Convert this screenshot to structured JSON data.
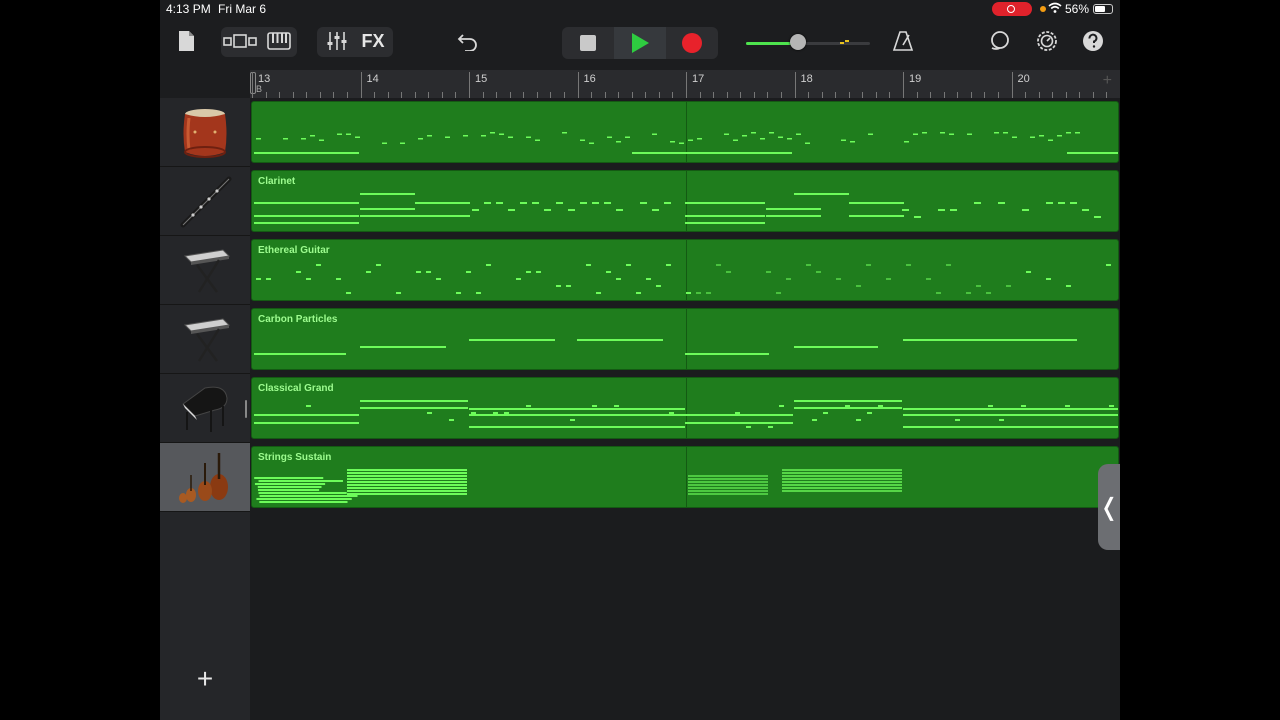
{
  "status_bar": {
    "time": "4:13 PM",
    "date": "Fri Mar 6",
    "battery": "56%"
  },
  "toolbar": {
    "fx_label": "FX",
    "icons": [
      "document-icon",
      "tracks-view-icon",
      "keyboard-icon",
      "mixer-icon",
      "undo-icon",
      "stop-icon",
      "play-icon",
      "record-icon",
      "metronome-icon",
      "loop-icon",
      "settings-icon",
      "help-icon"
    ]
  },
  "master_volume": 0.42,
  "ruler": {
    "bars": [
      "13",
      "14",
      "15",
      "16",
      "17",
      "18",
      "19",
      "20"
    ],
    "marker": "B"
  },
  "tracks": [
    {
      "name": "",
      "instrument": "taiko-drum-icon",
      "selected": false
    },
    {
      "name": "Clarinet",
      "instrument": "clarinet-icon",
      "selected": false
    },
    {
      "name": "Ethereal Guitar",
      "instrument": "keyboard-stand-icon",
      "selected": false
    },
    {
      "name": "Carbon Particles",
      "instrument": "keyboard-stand-icon",
      "selected": false
    },
    {
      "name": "Classical Grand",
      "instrument": "grand-piano-icon",
      "selected": false
    },
    {
      "name": "Strings Sustain",
      "instrument": "strings-icon",
      "selected": true
    }
  ],
  "colors": {
    "region": "#1f7d1d",
    "note": "#6dfc5a",
    "play": "#2ecc40",
    "record": "#e8222b"
  }
}
